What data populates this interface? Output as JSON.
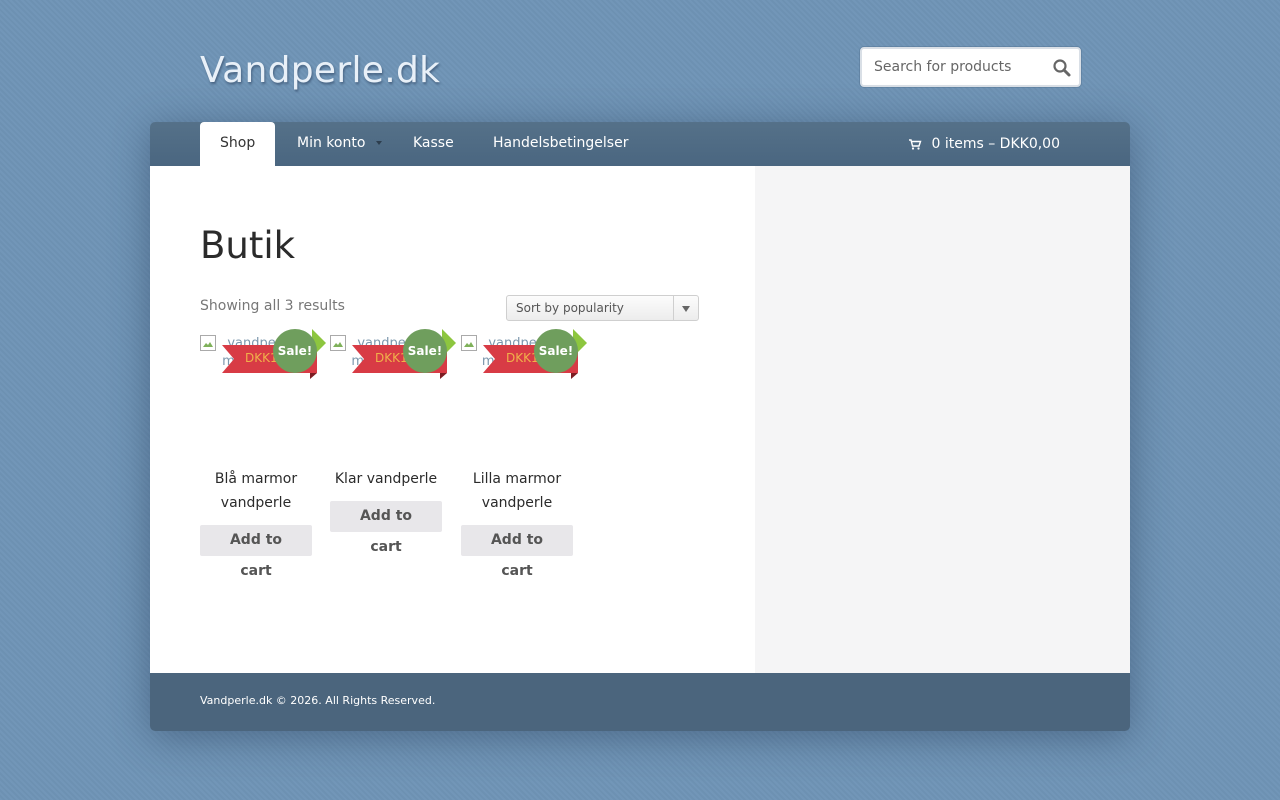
{
  "header": {
    "site_title": "Vandperle.dk",
    "search_placeholder": "Search for products"
  },
  "nav": {
    "items": [
      {
        "label": "Shop",
        "active": true
      },
      {
        "label": "Min konto",
        "active": false,
        "has_dropdown": true
      },
      {
        "label": "Kasse",
        "active": false
      },
      {
        "label": "Handelsbetingelser",
        "active": false
      }
    ],
    "cart_summary": "0 items – DKK0,00"
  },
  "main": {
    "page_title": "Butik",
    "result_count": "Showing all 3 results",
    "sort_selected": "Sort by popularity",
    "products": [
      {
        "name": "Blå marmor vandperle",
        "image_alt": "vandperle marmor blå",
        "price": "DKK1",
        "sale_label": "Sale!",
        "button_label": "Add to cart"
      },
      {
        "name": "Klar vandperle",
        "image_alt": "vandperle mellem klar",
        "price": "DKK1",
        "sale_label": "Sale!",
        "button_label": "Add to cart"
      },
      {
        "name": "Lilla marmor vandperle",
        "image_alt": "vandperle marmor lilla",
        "price": "DKK1",
        "sale_label": "Sale!",
        "button_label": "Add to cart"
      }
    ]
  },
  "footer": {
    "copyright": "Vandperle.dk © 2026. All Rights Reserved."
  },
  "colors": {
    "background": "#6f94b6",
    "navbar": "#4d6a83",
    "sale_badge": "#6f9e5d",
    "price_ribbon": "#d83b45",
    "sale_arrow": "#8dc63f"
  }
}
